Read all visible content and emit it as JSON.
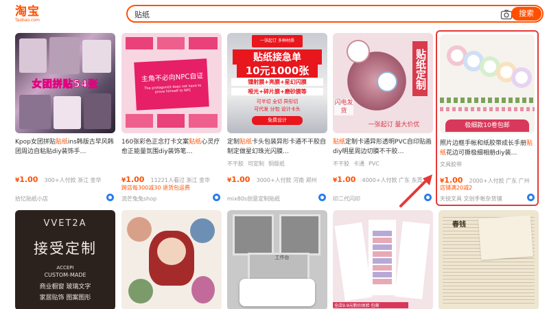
{
  "header": {
    "logo_main": "淘宝",
    "logo_sub": "Taobao.com",
    "search_value": "贴纸",
    "search_button": "搜索"
  },
  "products": [
    {
      "thumb_text": "女团拼贴54张",
      "title_pre": "Kpop女团拼贴",
      "title_kw": "贴纸",
      "title_post": "ins韩版古早风韩团周边自粘贴diy装饰手…",
      "tags": [],
      "price": "1.00",
      "sold": "300+人付款  浙江 金华",
      "promo": "",
      "shop": "拾忆贴纸小店"
    },
    {
      "thumb_text": "主角不必向NPC自证",
      "thumb_sub": "The protagonist does not have to prove himself to NPC",
      "title_pre": "160张彩色正念打卡文案",
      "title_kw": "贴纸",
      "title_post": "心灵疗愈正能量氛围diy装饰笔…",
      "tags": [],
      "price": "1.00",
      "sold": "11221人看过  浙江 金华",
      "promo": "跨店每300减30  退货包运费",
      "shop": "流芒兔兔shop"
    },
    {
      "thumb_badge": "一张起订 多种材质",
      "thumb_text": "贴纸接急单",
      "thumb_text2": "10元1000张",
      "thumb_lines": [
        "镭射膜+亮膜+星幻闪膜",
        "哑光+碎片膜+磨砂膜等",
        "可半切 全切 异形切",
        "可代发 分包 设计卡头"
      ],
      "thumb_tag": "免费设计",
      "title_pre": "定制",
      "title_kw": "贴纸",
      "title_post": "卡头包装异形卡通不干胶自制定做星幻珠光闪膜…",
      "tags": [
        "不干胶",
        "可定制",
        "铜版纸"
      ],
      "price": "1.00",
      "sold": "3000+人付款  河南 郑州",
      "promo": "",
      "shop": "mix80s创意定制贴纸"
    },
    {
      "thumb_side": "贴纸定制",
      "thumb_corner": "闪电发货",
      "thumb_bottom": "一张起订 量大价优",
      "title_pre": "",
      "title_kw": "贴纸",
      "title_post": "定制卡通异形透明PVC自印贴画diy明星周边切膜不干胶…",
      "tags": [
        "不干胶",
        "卡通",
        "PVC"
      ],
      "price": "1.00",
      "sold": "4000+人付款  广东 东莞",
      "promo": "",
      "shop": "印二代闪印"
    },
    {
      "thumb_bottom": "极细款10卷包邮",
      "title_pre": "照片边框手帐和纸胶带成长手册",
      "title_kw": "贴纸",
      "title_post": "花边可撕极细相册diy装…",
      "tags": [
        "文具胶带"
      ],
      "price": "1.00",
      "sold": "2000+人付款  广东 广州",
      "promo": "店铺满20减2",
      "shop": "天锐文具 文创手帐杂货铺"
    }
  ],
  "row2": [
    {
      "name": "row2-product-1",
      "thumb_top": "VVET2A",
      "thumb_text": "接受定制",
      "thumb_lines": [
        "ACCEPI",
        "CUSTOM-MADE",
        "商业橱窗 玻璃文字",
        "家居贴饰 图案图形"
      ]
    },
    {
      "name": "row2-product-2"
    },
    {
      "name": "row2-product-3",
      "thumb_text": "工作台"
    },
    {
      "name": "row2-product-4",
      "thumb_bottom": "全店9.9元新价体验 包邮"
    },
    {
      "name": "row2-product-5",
      "thumb_text": "春钱"
    }
  ],
  "colors": {
    "accent": "#ff5000",
    "highlight": "#e53935"
  }
}
